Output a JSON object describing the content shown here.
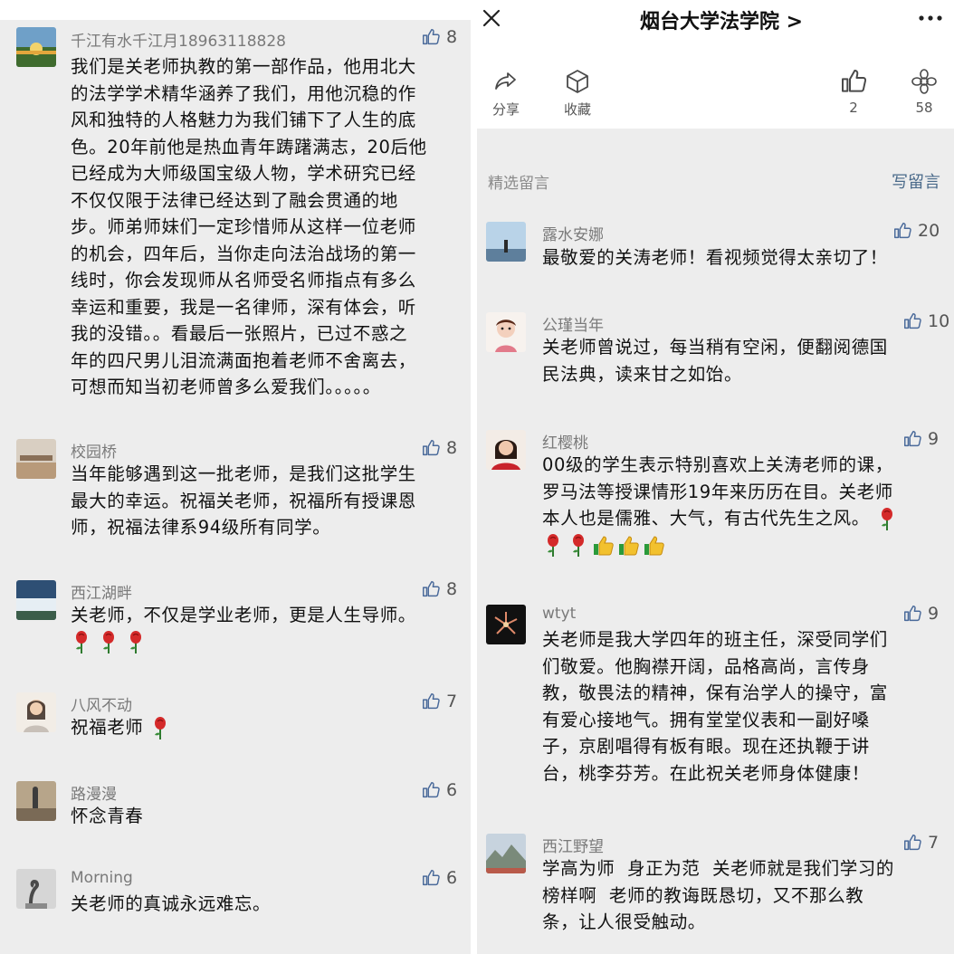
{
  "colors": {
    "panel_bg": "#ededed",
    "header_bg": "#ffffff",
    "link": "#4a6a8a",
    "muted": "#7a7a7a"
  },
  "left_comments": [
    {
      "name": "千江有水千江月18963118828",
      "likes": "8",
      "lines": [
        "我们是关老师执教的第一部作品，他用北大",
        "的法学学术精华涵养了我们，用他沉稳的作",
        "风和独特的人格魅力为我们铺下了人生的底",
        "色。20年前他是热血青年踌躇满志，20后他",
        "已经成为大师级国宝级人物，学术研究已经",
        "不仅仅限于法律已经达到了融会贯通的地",
        "步。师弟师妹们一定珍惜师从这样一位老师",
        "的机会，四年后，当你走向法治战场的第一",
        "线时，你会发现师从名师受名师指点有多么",
        "幸运和重要，我是一名律师，深有体会，听",
        "我的没错。。看最后一张照片，已过不惑之",
        "年的四尺男儿泪流满面抱着老师不舍离去，",
        "可想而知当初老师曾多么爱我们。。。。。"
      ],
      "emoji": []
    },
    {
      "name": "校园桥",
      "likes": "8",
      "lines": [
        "当年能够遇到这一批老师，是我们这批学生",
        "最大的幸运。祝福关老师，祝福所有授课恩",
        "师，祝福法律系94级所有同学。"
      ],
      "emoji": []
    },
    {
      "name": "西江湖畔",
      "likes": "8",
      "lines": [
        "关老师，不仅是学业老师，更是人生导师。"
      ],
      "emoji": [
        "rose",
        "rose",
        "rose"
      ]
    },
    {
      "name": "八风不动",
      "likes": "7",
      "lines": [
        "祝福老师"
      ],
      "inline_emoji": "rose",
      "emoji": []
    },
    {
      "name": "路漫漫",
      "likes": "6",
      "lines": [
        "怀念青春"
      ],
      "emoji": []
    },
    {
      "name": "Morning",
      "likes": "6",
      "lines": [
        "关老师的真诚永远难忘。"
      ],
      "emoji": []
    }
  ],
  "right_header": {
    "close_icon": "close-icon",
    "account": "烟台大学法学院 >",
    "more_icon": "more-icon",
    "share_label": "分享",
    "fav_label": "收藏",
    "like_count": "2",
    "wow_count": "58"
  },
  "section": {
    "label": "精选留言",
    "write": "写留言"
  },
  "right_comments": [
    {
      "name": "露水安娜",
      "likes": "20",
      "lines": [
        "最敬爱的关涛老师！看视频觉得太亲切了！"
      ],
      "emoji": []
    },
    {
      "name": "公瑾当年",
      "likes": "10",
      "lines": [
        "关老师曾说过，每当稍有空闲，便翻阅德国",
        "民法典，读来甘之如饴。"
      ],
      "emoji": []
    },
    {
      "name": "红樱桃",
      "likes": "9",
      "lines": [
        "00级的学生表示特别喜欢上关涛老师的课，",
        "罗马法等授课情形19年来历历在目。关老师",
        "本人也是儒雅、大气，有古代先生之风。"
      ],
      "inline_emoji": "rose",
      "emoji": [
        "rose",
        "rose",
        "thumb",
        "thumb",
        "thumb"
      ]
    },
    {
      "name": "wtyt",
      "likes": "9",
      "lines": [
        "关老师是我大学四年的班主任，深受同学们",
        "们敬爱。他胸襟开阔，品格高尚，言传身",
        "教，敬畏法的精神，保有治学人的操守，富",
        "有爱心接地气。拥有堂堂仪表和一副好嗓",
        "子，京剧唱得有板有眼。现在还执鞭于讲",
        "台，桃李芬芳。在此祝关老师身体健康！"
      ],
      "emoji": []
    },
    {
      "name": "西江野望",
      "likes": "7",
      "lines": [
        "学高为师  身正为范  关老师就是我们学习的",
        "榜样啊  老师的教诲既恳切，又不那么教",
        "条，让人很受触动。"
      ],
      "emoji": []
    }
  ]
}
